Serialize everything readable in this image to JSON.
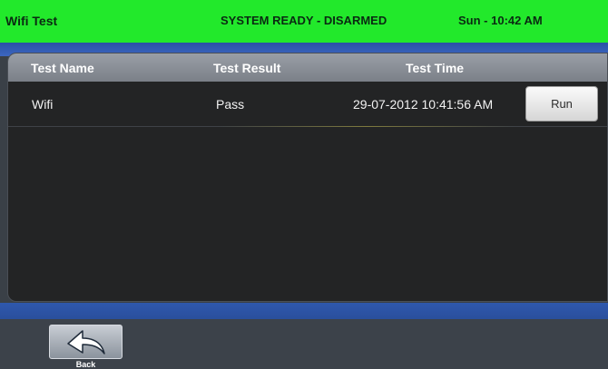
{
  "status_bar": {
    "title": "Wifi Test",
    "system_state": "SYSTEM READY - DISARMED",
    "clock": "Sun - 10:42 AM",
    "color": "#22e92b"
  },
  "table": {
    "columns": [
      "Test Name",
      "Test Result",
      "Test Time"
    ],
    "rows": [
      {
        "name": "Wifi",
        "result": "Pass",
        "time": "29-07-2012 10:41:56 AM",
        "action": "Run"
      }
    ]
  },
  "footer": {
    "back_label": "Back",
    "back_icon": "back-arrow-icon"
  }
}
